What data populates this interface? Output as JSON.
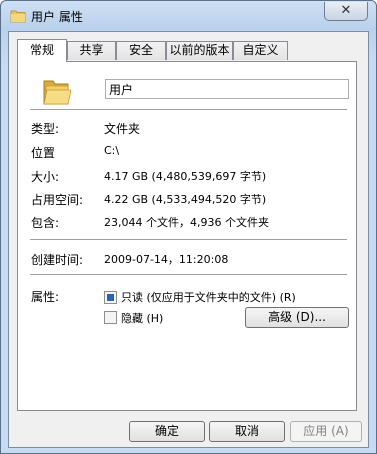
{
  "window": {
    "title": "用户 属性",
    "close_label": "✕"
  },
  "tabs": [
    {
      "label": "常规",
      "active": true
    },
    {
      "label": "共享"
    },
    {
      "label": "安全"
    },
    {
      "label": "以前的版本"
    },
    {
      "label": "自定义"
    }
  ],
  "general": {
    "name_value": "用户",
    "type_label": "类型:",
    "type_value": "文件夹",
    "location_label": "位置",
    "location_value": "C:\\",
    "size_label": "大小:",
    "size_value": "4.17 GB (4,480,539,697 字节)",
    "disk_size_label": "占用空间:",
    "disk_size_value": "4.22 GB (4,533,494,520 字节)",
    "contains_label": "包含:",
    "contains_value": "23,044 个文件，4,936 个文件夹",
    "created_label": "创建时间:",
    "created_value": "2009-07-14，11:20:08",
    "attributes_label": "属性:",
    "readonly_label": "只读 (仅应用于文件夹中的文件) (R)",
    "readonly_checked": true,
    "hidden_label": "隐藏 (H)",
    "hidden_checked": false,
    "advanced_label": "高级 (D)..."
  },
  "buttons": {
    "ok": "确定",
    "cancel": "取消",
    "apply": "应用 (A)"
  },
  "colors": {
    "checkbox_fill": "#2a64b6",
    "folder_yellow": "#e8c45a"
  }
}
